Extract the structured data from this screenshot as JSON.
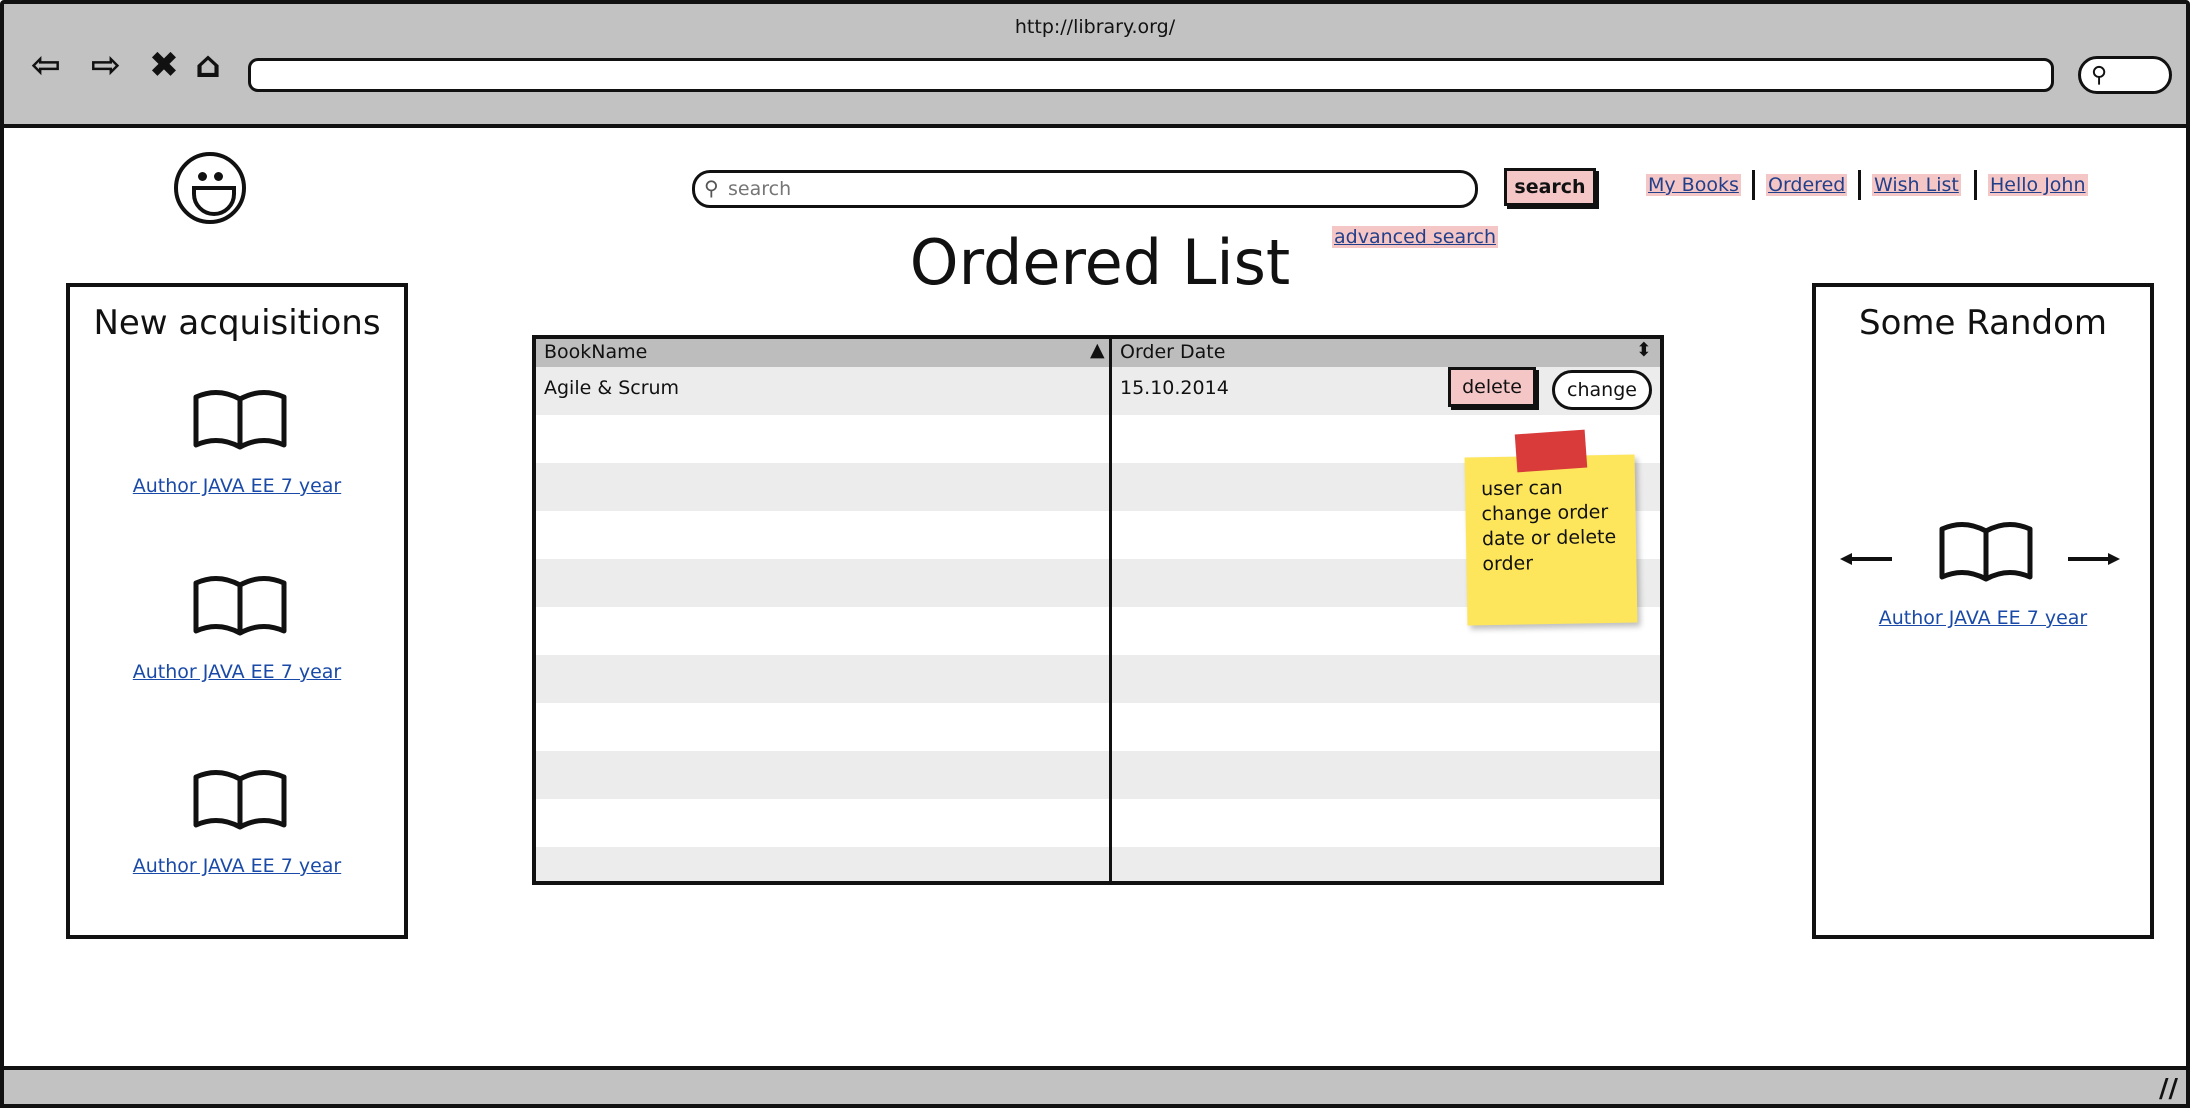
{
  "browser": {
    "url": "http://library.org/",
    "nav_icons": [
      "back-icon",
      "forward-icon",
      "close-icon",
      "home-icon"
    ]
  },
  "header": {
    "search_placeholder": "search",
    "search_button": "search",
    "links": [
      "My Books",
      "Ordered",
      "Wish List",
      "Hello John"
    ],
    "advanced_search": "advanced search"
  },
  "page": {
    "title": "Ordered List"
  },
  "left_panel": {
    "title": "New acquisitions",
    "items": [
      "Author JAVA EE 7 year",
      "Author JAVA EE 7 year",
      "Author JAVA EE 7 year"
    ]
  },
  "right_panel": {
    "title": "Some Random",
    "item": "Author JAVA EE 7 year"
  },
  "table": {
    "columns": [
      "BookName",
      "Order Date"
    ],
    "rows": [
      {
        "book": "Agile & Scrum",
        "date": "15.10.2014"
      }
    ],
    "delete_label": "delete",
    "change_label": "change"
  },
  "note": {
    "text": "user can change order date or delete order"
  },
  "colors": {
    "chrome": "#c2c2c2",
    "highlight": "#f4c6c6",
    "link": "#1a4aa8",
    "sticky": "#fde65c"
  }
}
